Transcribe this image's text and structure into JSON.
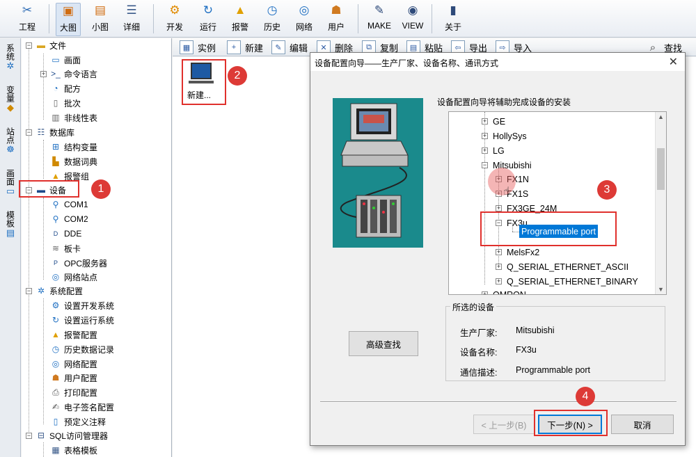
{
  "toolbar": {
    "items": [
      {
        "label": "工程",
        "icon": "tools-icon"
      },
      {
        "label": "大图",
        "icon": "large-icons-icon"
      },
      {
        "label": "小图",
        "icon": "small-icons-icon"
      },
      {
        "label": "详细",
        "icon": "details-icon"
      },
      {
        "label": "开发",
        "icon": "develop-icon"
      },
      {
        "label": "运行",
        "icon": "run-icon"
      },
      {
        "label": "报警",
        "icon": "alarm-icon"
      },
      {
        "label": "历史",
        "icon": "history-icon"
      },
      {
        "label": "网络",
        "icon": "network-icon"
      },
      {
        "label": "用户",
        "icon": "user-icon"
      },
      {
        "label": "MAKE",
        "icon": "make-icon"
      },
      {
        "label": "VIEW",
        "icon": "view-icon"
      },
      {
        "label": "关于",
        "icon": "about-icon"
      }
    ]
  },
  "side_tabs": [
    "系统",
    "变量",
    "站点",
    "画面",
    "模板"
  ],
  "tree": {
    "items": [
      {
        "label": "文件"
      },
      {
        "label": "画面"
      },
      {
        "label": "命令语言"
      },
      {
        "label": "配方"
      },
      {
        "label": "批次"
      },
      {
        "label": "非线性表"
      },
      {
        "label": "数据库"
      },
      {
        "label": "结构变量"
      },
      {
        "label": "数据词典"
      },
      {
        "label": "报警组"
      },
      {
        "label": "设备"
      },
      {
        "label": "COM1"
      },
      {
        "label": "COM2"
      },
      {
        "label": "DDE"
      },
      {
        "label": "板卡"
      },
      {
        "label": "OPC服务器"
      },
      {
        "label": "网络站点"
      },
      {
        "label": "系统配置"
      },
      {
        "label": "设置开发系统"
      },
      {
        "label": "设置运行系统"
      },
      {
        "label": "报警配置"
      },
      {
        "label": "历史数据记录"
      },
      {
        "label": "网络配置"
      },
      {
        "label": "用户配置"
      },
      {
        "label": "打印配置"
      },
      {
        "label": "电子签名配置"
      },
      {
        "label": "预定义注释"
      },
      {
        "label": "SQL访问管理器"
      },
      {
        "label": "表格模板"
      }
    ]
  },
  "main_toolbar": {
    "items": [
      "实例",
      "新建",
      "编辑",
      "删除",
      "复制",
      "粘贴",
      "导出",
      "导入",
      "查找"
    ]
  },
  "main": {
    "new_item_label": "新建..."
  },
  "dialog": {
    "title": "设备配置向导——生产厂家、设备名称、通讯方式",
    "close": "✕",
    "caption": "设备配置向导将辅助完成设备的安装",
    "tree": [
      {
        "label": "GE"
      },
      {
        "label": "HollySys"
      },
      {
        "label": "LG"
      },
      {
        "label": "Mitsubishi"
      },
      {
        "label": "FX1N"
      },
      {
        "label": "FX1S"
      },
      {
        "label": "FX3GE_24M"
      },
      {
        "label": "FX3u"
      },
      {
        "label": "Programmable port"
      },
      {
        "label": "MelsFx2"
      },
      {
        "label": "Q_SERIAL_ETHERNET_ASCII"
      },
      {
        "label": "Q_SERIAL_ETHERNET_BINARY"
      },
      {
        "label": "OMRON"
      }
    ],
    "selected_group": {
      "legend": "所选的设备",
      "manufacturer_label": "生产厂家:",
      "manufacturer_value": "Mitsubishi",
      "device_label": "设备名称:",
      "device_value": "FX3u",
      "comm_label": "通信描述:",
      "comm_value": "Programmable port"
    },
    "advanced_search": "高级查找",
    "prev": "< 上一步(B)",
    "next": "下一步(N) >",
    "cancel": "取消"
  },
  "annotations": [
    "1",
    "2",
    "3",
    "4"
  ],
  "colors": {
    "accent_red": "#dd3a36",
    "selection": "#0078d7",
    "illustration_bg": "#1a8a8c"
  }
}
